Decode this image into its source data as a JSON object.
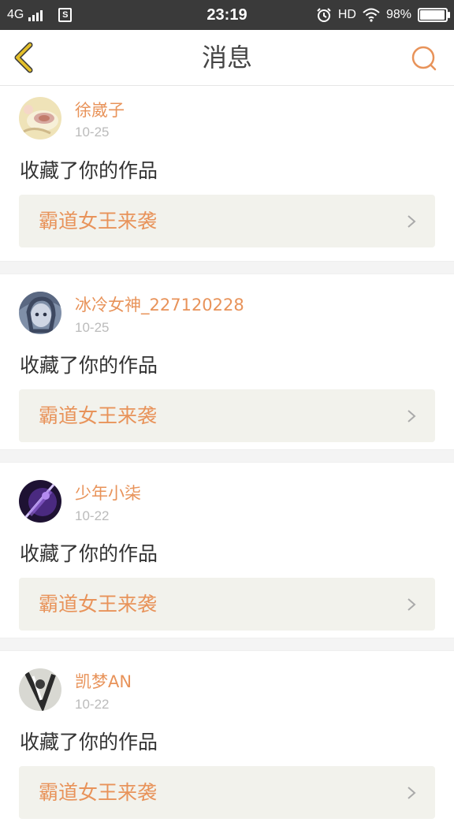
{
  "status_bar": {
    "network": "4G",
    "sim_label": "S",
    "time": "23:19",
    "hd_label": "HD",
    "battery_text": "98%",
    "battery_level": 0.98
  },
  "nav": {
    "back_icon": "chevron-left-icon",
    "title": "消息",
    "search_icon": "search-icon"
  },
  "colors": {
    "accent": "#e8935a",
    "back_icon_color": "#e3bf2a",
    "box_bg": "#f2f2ec"
  },
  "messages": [
    {
      "user": "徐崴子",
      "date": "10-25",
      "action": "收藏了你的作品",
      "work": "霸道女王来袭"
    },
    {
      "user": "冰冷女神_227120228",
      "date": "10-25",
      "action": "收藏了你的作品",
      "work": "霸道女王来袭"
    },
    {
      "user": "少年小柒",
      "date": "10-22",
      "action": "收藏了你的作品",
      "work": "霸道女王来袭"
    },
    {
      "user": "凯梦AN",
      "date": "10-22",
      "action": "收藏了你的作品",
      "work": "霸道女王来袭"
    }
  ]
}
